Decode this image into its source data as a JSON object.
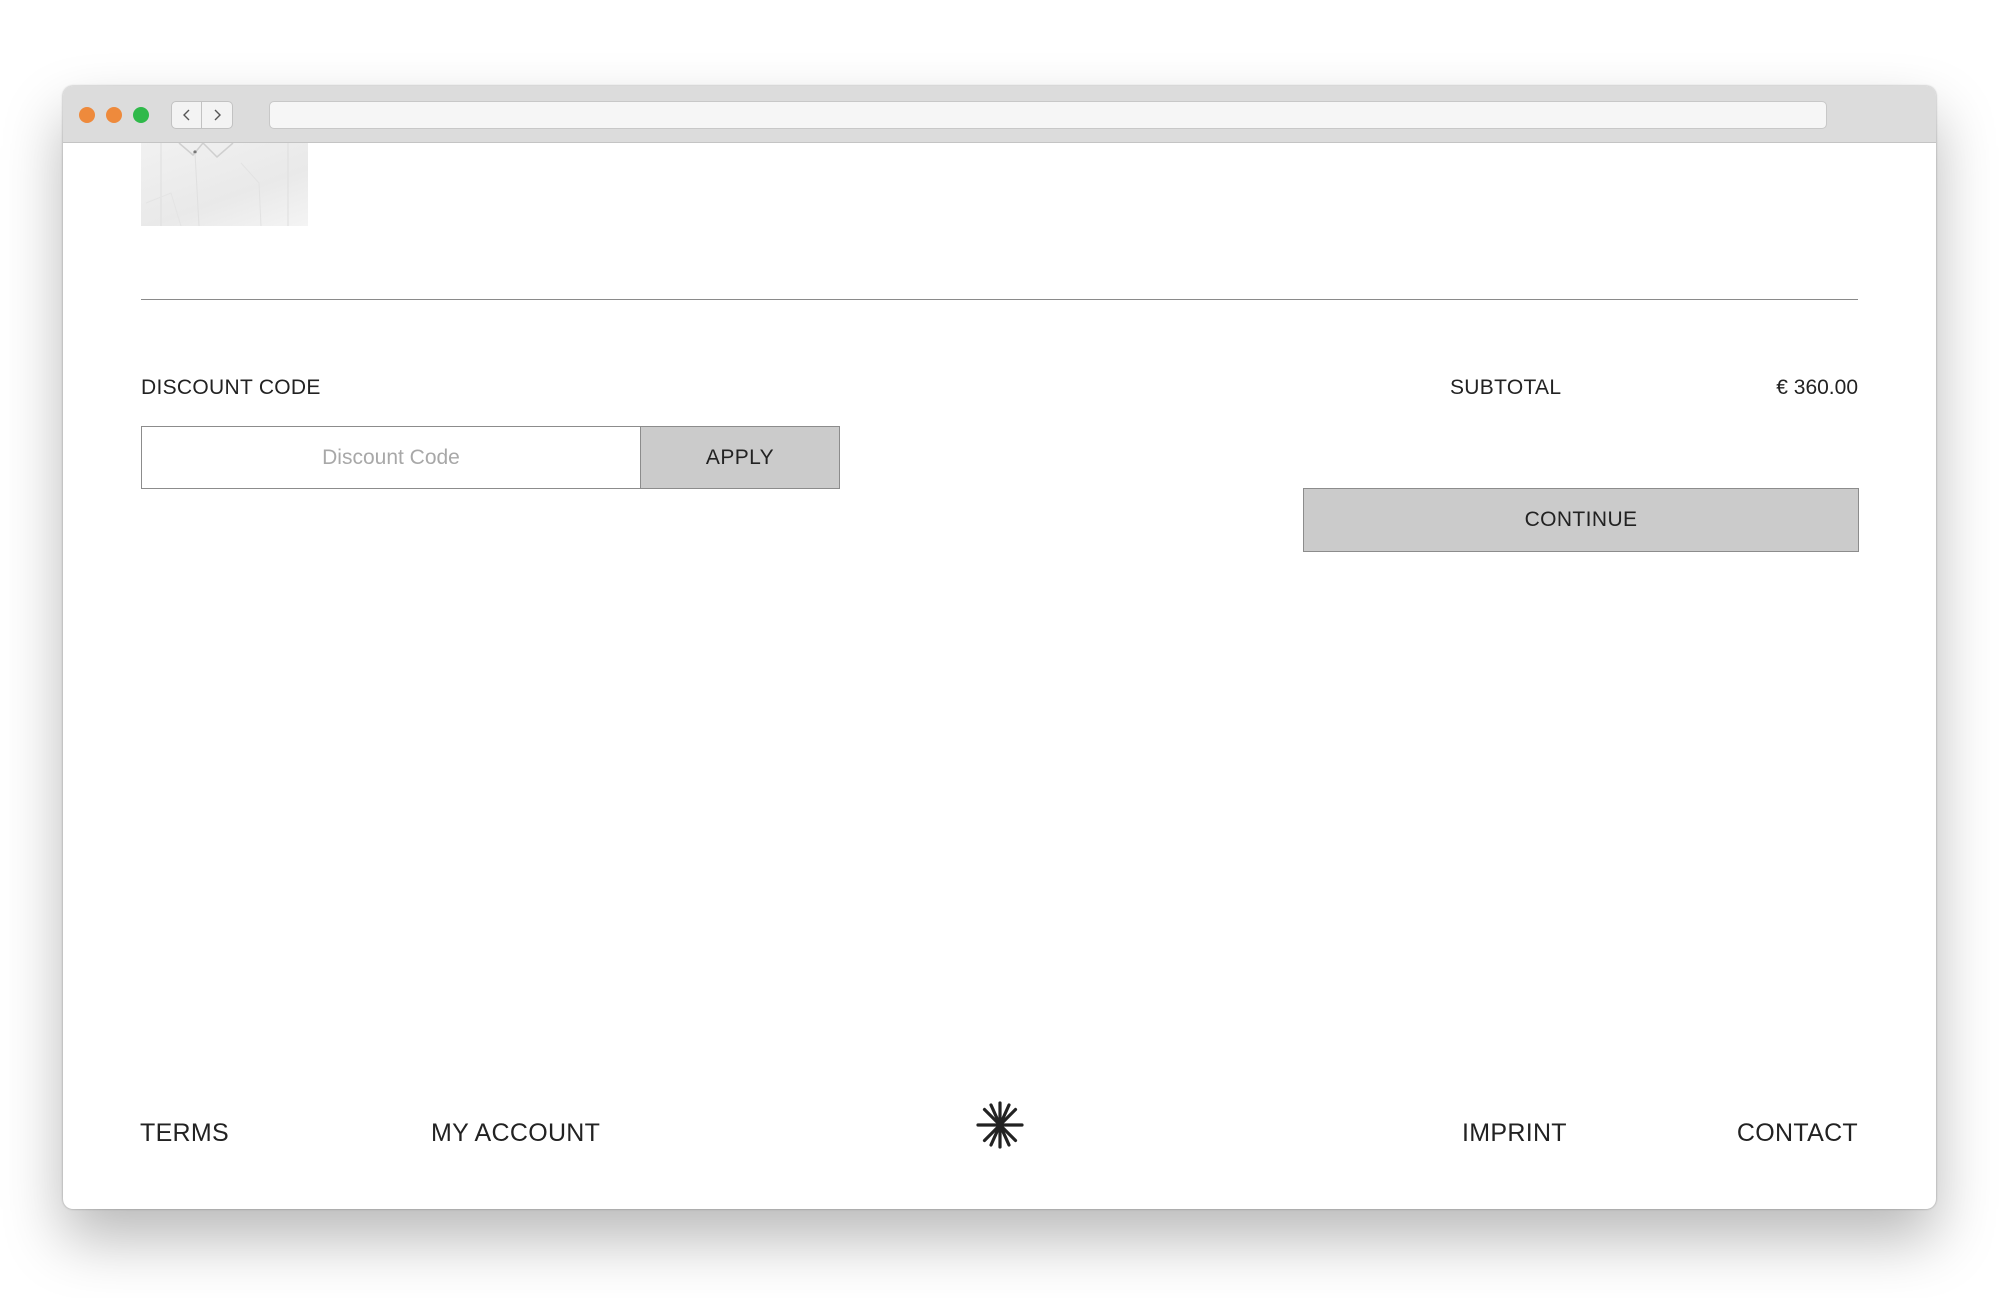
{
  "browser": {
    "back_icon": "chevron-left-icon",
    "forward_icon": "chevron-right-icon",
    "url": ""
  },
  "cart": {
    "discount": {
      "label": "DISCOUNT CODE",
      "placeholder": "Discount Code",
      "value": "",
      "apply_label": "APPLY"
    },
    "subtotal": {
      "label": "SUBTOTAL",
      "value": "€ 360.00"
    },
    "continue_label": "CONTINUE"
  },
  "footer": {
    "links": [
      "TERMS",
      "MY ACCOUNT",
      "IMPRINT",
      "CONTACT"
    ],
    "logo_icon": "asterisk-logo-icon"
  },
  "colors": {
    "button_bg": "#cbcbcb",
    "text": "#222222",
    "traffic_close": "#ee8a3c",
    "traffic_min": "#ee8a3c",
    "traffic_max": "#2fb94a"
  }
}
